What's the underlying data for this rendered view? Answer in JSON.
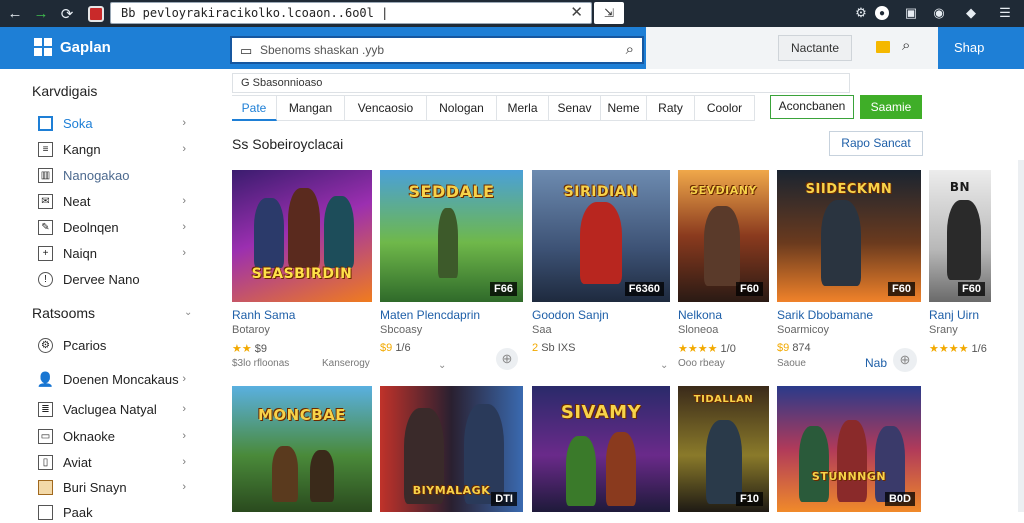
{
  "browser": {
    "url": "Bb pevloyrakiracikolko.lcoaon..6o0l |",
    "back_icon": "arrow-left-icon",
    "forward_icon": "arrow-right-icon",
    "reload_icon": "reload-icon",
    "tab_button_icon": "tab-icon"
  },
  "header": {
    "logo_text": "Gaplan",
    "search_placeholder": "Sbenoms shaskan .yyb",
    "right_button": "Nactante",
    "signup": "Shap",
    "brand_color": "#1e7fd6"
  },
  "sidebar": {
    "heading1": "Karvdigais",
    "items": [
      {
        "label": "Soka",
        "icon": "square-icon",
        "chevron": "›"
      },
      {
        "label": "Kangn",
        "icon": "list-icon",
        "chevron": "›"
      },
      {
        "label": "Nanogakao",
        "icon": "grid-icon",
        "chevron": ""
      },
      {
        "label": "Neat",
        "icon": "mail-icon",
        "chevron": "›"
      },
      {
        "label": "Deolnqen",
        "icon": "edit-icon",
        "chevron": "›"
      },
      {
        "label": "Naiqn",
        "icon": "plus-icon",
        "chevron": "›"
      },
      {
        "label": "Dervee Nano",
        "icon": "shield-icon",
        "chevron": ""
      }
    ],
    "heading2": "Ratsooms",
    "items2": [
      {
        "label": "Pcarios",
        "icon": "gear-icon",
        "chevron": ""
      },
      {
        "label": "Doenen Moncakaus",
        "icon": "user-icon",
        "chevron": "›"
      },
      {
        "label": "Vaclugea Natyal",
        "icon": "document-icon",
        "chevron": "›"
      },
      {
        "label": "Oknaoke",
        "icon": "card-icon",
        "chevron": "›"
      },
      {
        "label": "Aviat",
        "icon": "bookmark-icon",
        "chevron": "›"
      },
      {
        "label": "Buri Snayn",
        "icon": "folder-icon",
        "chevron": "›"
      },
      {
        "label": "Paak",
        "icon": "box-icon",
        "chevron": ""
      }
    ]
  },
  "breadcrumb": "G Sbasonnioaso",
  "filters": [
    "Pate",
    "Mangan",
    "Vencaosio",
    "Nologan",
    "Merla",
    "Senav",
    "Neme",
    "Raty",
    "Coolor"
  ],
  "filter_outline_button": "Aconcbanen",
  "filter_green_button": "Saamie",
  "section_title": "Ss Sobeiroyclacai",
  "sort_button": "Rapo Sancat",
  "row1": [
    {
      "title": "Ranh Sama",
      "subtitle": "Botaroy",
      "rating_stars": "★★",
      "rating_text": "$9",
      "meta": "$3lo rfloonas",
      "badge": "Kanserogy",
      "art_title": "SEASBIRDIN",
      "price": ""
    },
    {
      "title": "Maten Plencdaprin",
      "subtitle": "Sbcoasy",
      "rating_stars": "$9",
      "rating_text": "1/6",
      "meta": "",
      "badge": "",
      "art_title": "SEDDALE",
      "price": "F66"
    },
    {
      "title": "Goodon Sanjn",
      "subtitle": "Saa",
      "rating_stars": "2",
      "rating_text": "Sb IXS",
      "meta": "",
      "badge": "",
      "art_title": "SIRIDIAN",
      "price": "F6360"
    },
    {
      "title": "Nelkona",
      "subtitle": "Sloneoa",
      "rating_stars": "★★★★",
      "rating_text": "1/0",
      "meta": "Ooo rbeay",
      "badge": "",
      "art_title": "SEVDIANY",
      "price": "F60"
    },
    {
      "title": "Sarik Dbobamane",
      "subtitle": "Soarmicoy",
      "rating_stars": "$9",
      "rating_text": "874",
      "meta": "Saoue",
      "badge": "Nab",
      "art_title": "SIIDECKMN",
      "price": "F60"
    },
    {
      "title": "Ranj Uirn",
      "subtitle": "Srany",
      "rating_stars": "★★★★",
      "rating_text": "1/6",
      "meta": "",
      "badge": "",
      "art_title": "BN",
      "price": "F60"
    }
  ],
  "row2": [
    {
      "art_title": "MONCBAE",
      "price": ""
    },
    {
      "art_title": "BIYMALAGK",
      "price": "DTI"
    },
    {
      "art_title": "SIVAMY",
      "price": ""
    },
    {
      "art_title": "TIDALLAN",
      "price": "F10"
    },
    {
      "art_title": "STUNNNGN",
      "price": "B0D"
    }
  ]
}
